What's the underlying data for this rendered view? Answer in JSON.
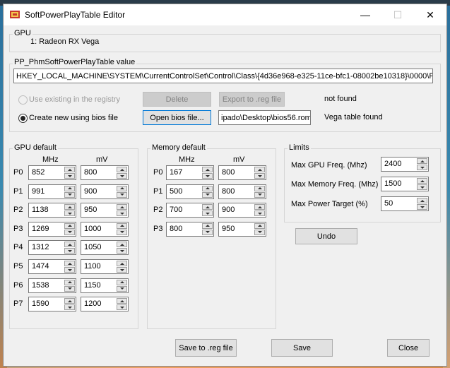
{
  "window": {
    "title": "SoftPowerPlayTable Editor",
    "min_glyph": "—",
    "max_glyph": "☐",
    "close_glyph": "✕"
  },
  "gpu": {
    "label": "GPU",
    "name": "1: Radeon RX Vega"
  },
  "pptable": {
    "label": "PP_PhmSoftPowerPlayTable value",
    "registry_path": "HKEY_LOCAL_MACHINE\\SYSTEM\\CurrentControlSet\\Control\\Class\\{4d36e968-e325-11ce-bfc1-08002be10318}\\0000\\PP_",
    "use_existing_label": "Use existing in the registry",
    "delete_label": "Delete",
    "export_label": "Export to .reg file",
    "registry_status": "not found",
    "create_new_label": "Create new using bios file",
    "open_bios_label": "Open bios file...",
    "bios_path": "ipado\\Desktop\\bios56.rom",
    "bios_status": "Vega table found"
  },
  "gpu_default": {
    "label": "GPU default",
    "col_mhz": "MHz",
    "col_mv": "mV",
    "rows": [
      {
        "state": "P0",
        "mhz": "852",
        "mv": "800"
      },
      {
        "state": "P1",
        "mhz": "991",
        "mv": "900"
      },
      {
        "state": "P2",
        "mhz": "1138",
        "mv": "950"
      },
      {
        "state": "P3",
        "mhz": "1269",
        "mv": "1000"
      },
      {
        "state": "P4",
        "mhz": "1312",
        "mv": "1050"
      },
      {
        "state": "P5",
        "mhz": "1474",
        "mv": "1100"
      },
      {
        "state": "P6",
        "mhz": "1538",
        "mv": "1150"
      },
      {
        "state": "P7",
        "mhz": "1590",
        "mv": "1200"
      }
    ]
  },
  "memory_default": {
    "label": "Memory default",
    "col_mhz": "MHz",
    "col_mv": "mV",
    "rows": [
      {
        "state": "P0",
        "mhz": "167",
        "mv": "800"
      },
      {
        "state": "P1",
        "mhz": "500",
        "mv": "800"
      },
      {
        "state": "P2",
        "mhz": "700",
        "mv": "900"
      },
      {
        "state": "P3",
        "mhz": "800",
        "mv": "950"
      }
    ]
  },
  "limits": {
    "label": "Limits",
    "max_gpu_label": "Max GPU Freq. (Mhz)",
    "max_gpu_value": "2400",
    "max_mem_label": "Max Memory Freq. (Mhz)",
    "max_mem_value": "1500",
    "max_power_label": "Max Power Target (%)",
    "max_power_value": "50"
  },
  "actions": {
    "undo_label": "Undo",
    "save_reg_label": "Save to .reg file",
    "save_label": "Save",
    "close_label": "Close"
  }
}
